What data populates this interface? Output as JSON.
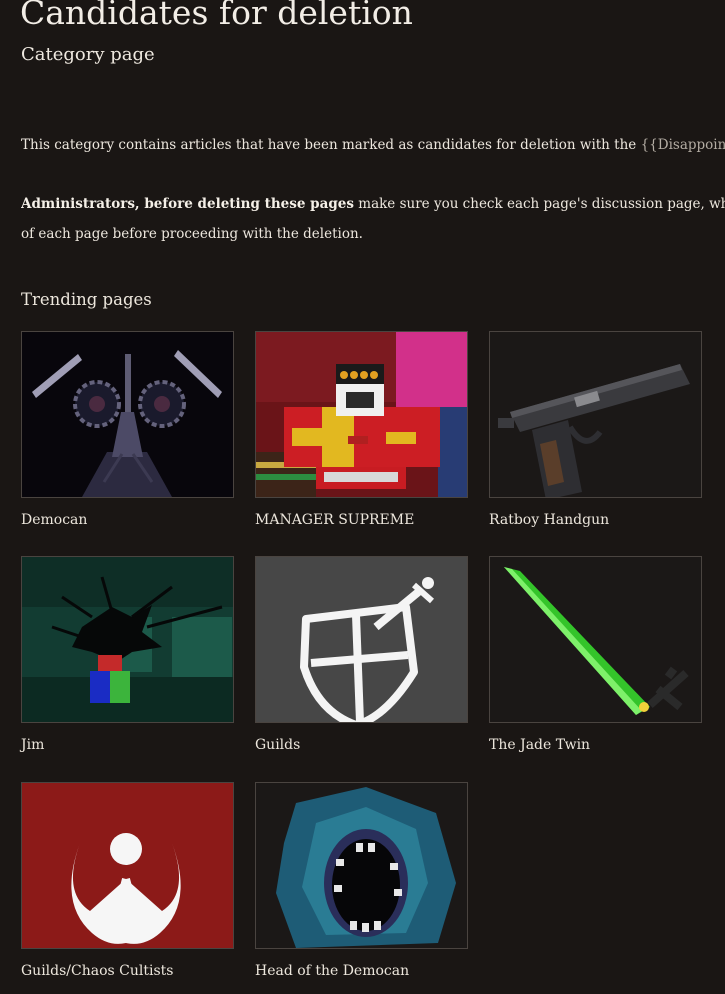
{
  "page": {
    "title": "Candidates for deletion",
    "subtitle": "Category page"
  },
  "content": {
    "para1_text": "This category contains articles that have been marked as candidates for deletion with the ",
    "para1_link": "{{Disappointment",
    "para2_bold": "Administrators, before deleting these pages",
    "para2_rest": " make sure you check each page's discussion page, what links",
    "para2_line2": "of each page before proceeding with the deletion."
  },
  "trending": {
    "heading": "Trending pages",
    "items": [
      {
        "label": "Democan",
        "icon": "democan-thumbnail"
      },
      {
        "label": "MANAGER SUPREME",
        "icon": "manager-supreme-thumbnail"
      },
      {
        "label": "Ratboy Handgun",
        "icon": "handgun-thumbnail"
      },
      {
        "label": "Jim",
        "icon": "jim-thumbnail"
      },
      {
        "label": "Guilds",
        "icon": "shield-sword-thumbnail"
      },
      {
        "label": "The Jade Twin",
        "icon": "green-sword-thumbnail"
      },
      {
        "label": "Guilds/Chaos Cultists",
        "icon": "chaos-symbol-thumbnail"
      },
      {
        "label": "Head of the Democan",
        "icon": "monster-head-thumbnail"
      }
    ]
  },
  "colors": {
    "background": "#1a1614",
    "text": "#ece6dc",
    "link": "#b3aca3",
    "thumb_border": "#4a4440"
  }
}
